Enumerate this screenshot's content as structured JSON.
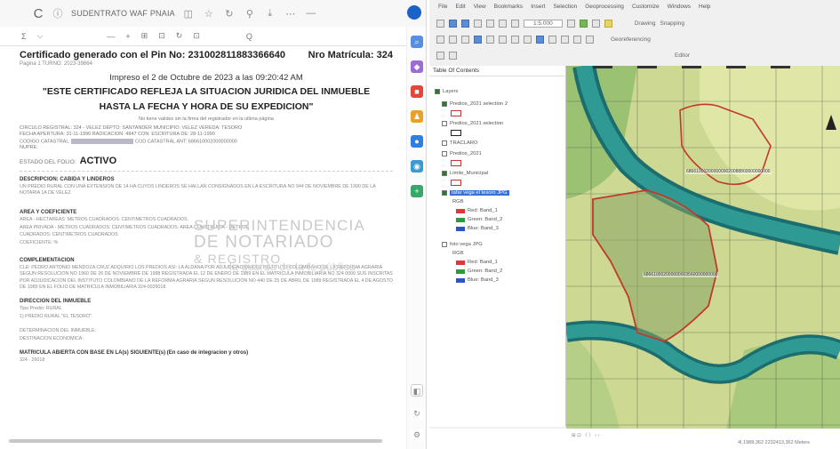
{
  "browser": {
    "url": "SUDENTRATO WAF PNAIA",
    "toolbar": [
      "Σ",
      "⌵",
      "—",
      "+",
      "⊞",
      "⊡",
      "↻",
      "⊡",
      "Q"
    ]
  },
  "document": {
    "title": "Certificado generado con el Pin No: 231002811883366640",
    "matricula": "Nro Matrícula: 324",
    "pagina": "Pagina 1 TURNO: 2023-39864",
    "impreso": "Impreso el 2 de Octubre de 2023 a las 09:20:42 AM",
    "reflect_1": "\"ESTE CERTIFICADO REFLEJA LA SITUACION JURIDICA DEL INMUEBLE",
    "reflect_2": "HASTA LA FECHA Y HORA DE SU EXPEDICION\"",
    "note": "No tiene validez sin la firma del registrador en la ultima página",
    "circulo": "CIRCULO REGISTRAL: 324 - VELEZ  DEPTO: SANTANDER  MUNICIPIO: VELEZ  VEREDA: TESORO",
    "fecha": "FECHA APERTURA: 31-11-1990  RADICACION: 4847  CON: ESCRITURA DE: 28-11-1990",
    "codigo": "CODIGO CATASTRAL:",
    "codigo_2": "COD CATASTRAL ANT: 686610002000000000",
    "nupre": "NUPRE:",
    "estado_label": "ESTADO DEL FOLIO:",
    "estado_value": "ACTIVO",
    "desc_head": "DESCRIPCION: CABIDA Y LINDEROS",
    "desc_text": "UN PREDIO RURAL CON UNA EXTENSION DE 14 HA CUYOS LINDEROS SE HALLAN CONSIGNADOS EN LA ESCRITURA NO 944 DE NOVIEMBRE DE 1990 DE LA NOTARIA 1A DE VELEZ",
    "area_head": "AREA Y COEFICIENTE",
    "area_text": "AREA - HECTAREAS:  METROS CUADRADOS:  CENTIMETROS CUADRADOS:",
    "area_priv": "AREA PRIVADA - METROS CUADRADOS:  CENTIMETROS CUADRADOS:  AREA CONSTRUIDA - METROS CUADRADOS:  CENTIMETROS CUADRADOS",
    "coef": "COEFICIENTE: %",
    "comp_head": "COMPLEMENTACION",
    "comp_text": "CLE: PEDRO ANTONIO MENDOZA CRUZ ADQUIRIO LOS PREDIOS ASI: LA ALDANA POR ADJUDICACION DEL INSTITUTO COLOMBIANO DE LA REFORMA AGRARIA SEGUN RESOLUCION NO 1960 DE 26 DE NOVIEMBRE DE 1988 REGISTRADA EL 12 DE ENERO DE 1989 EN EL MATRICULA INMOBILIARIA NO 324 0000 SUS INSCRITAS POR ADJUDICACION DEL INSTITUTO COLOMBIANO DE LA REFORMA AGRARIA SEGUN RESOLUCION NO 440 DE 25 DE ABRIL DE 1989 REGISTRADA EL 4 DE AGOSTO DE 1989 EN EL FOLIO DE MATRICULA INMOBILIARIA 324-0026018",
    "dir_head": "DIRECCION DEL INMUEBLE",
    "dir_tipo": "Tipo Predio: RURAL",
    "dir_text": "1) PREDIO RURAL \"EL TESORO\"",
    "det_head": "DETERMINACION DEL INMUEBLE:",
    "dest": "DESTINACION ECONOMICA:",
    "mat_head": "MATRICULA ABIERTA CON BASE EN LA(s) SIGUIENTE(s) (En caso de integracion y otros)",
    "mat_val": "324 - 26018",
    "watermark_1": "SUPERINTENDENCIA",
    "watermark_2": "DE NOTARIADO",
    "watermark_3": "& REGISTRO",
    "watermark_4": "la guarda de la fe pública"
  },
  "gis": {
    "menu": [
      "File",
      "Edit",
      "View",
      "Bookmarks",
      "Insert",
      "Selection",
      "Geoprocessing",
      "Customize",
      "Windows",
      "Help"
    ],
    "scale": "1:5.000",
    "drawing": "Drawing",
    "snapping": "Snapping",
    "georef": "Georeferencing",
    "editor": "Editor",
    "toc_title": "Table Of Contents",
    "layers_label": "Layers",
    "layers": [
      {
        "label": "Predios_2021 selection 2",
        "checked": true
      },
      {
        "label": "Predios_2021 selection",
        "checked": false
      },
      {
        "label": "TRACLARO",
        "checked": false
      },
      {
        "label": "Predios_2021",
        "checked": false
      },
      {
        "label": "Limite_Municipal",
        "checked": true
      },
      {
        "label": "tafar vega el tesoro JPG",
        "checked": true,
        "selected": true
      },
      {
        "label": "foto vega JPG",
        "checked": false
      }
    ],
    "rgb": "RGB",
    "bands": [
      "Red: Band_1",
      "Green: Band_2",
      "Blue: Band_3"
    ],
    "band_colors": [
      "#e0383a",
      "#2e9a3a",
      "#2a56c8"
    ],
    "parcel_label_1": "6866100020000000020088800000000000",
    "parcel_label_2": "686610002000000003560000000000",
    "coords": "4I,1988,362  2232413,362 Meters",
    "paging": "⊞ ⊡ 〈 〉 ‹ ›"
  },
  "colors": {
    "river": "#2b8a8a",
    "river_edge": "#1c6e6e",
    "parcel": "#c0392b",
    "land_light": "#d9e3a0",
    "land_mid": "#b9cf84",
    "land_dark": "#8fb56a",
    "veg": "#9cbf6e"
  }
}
